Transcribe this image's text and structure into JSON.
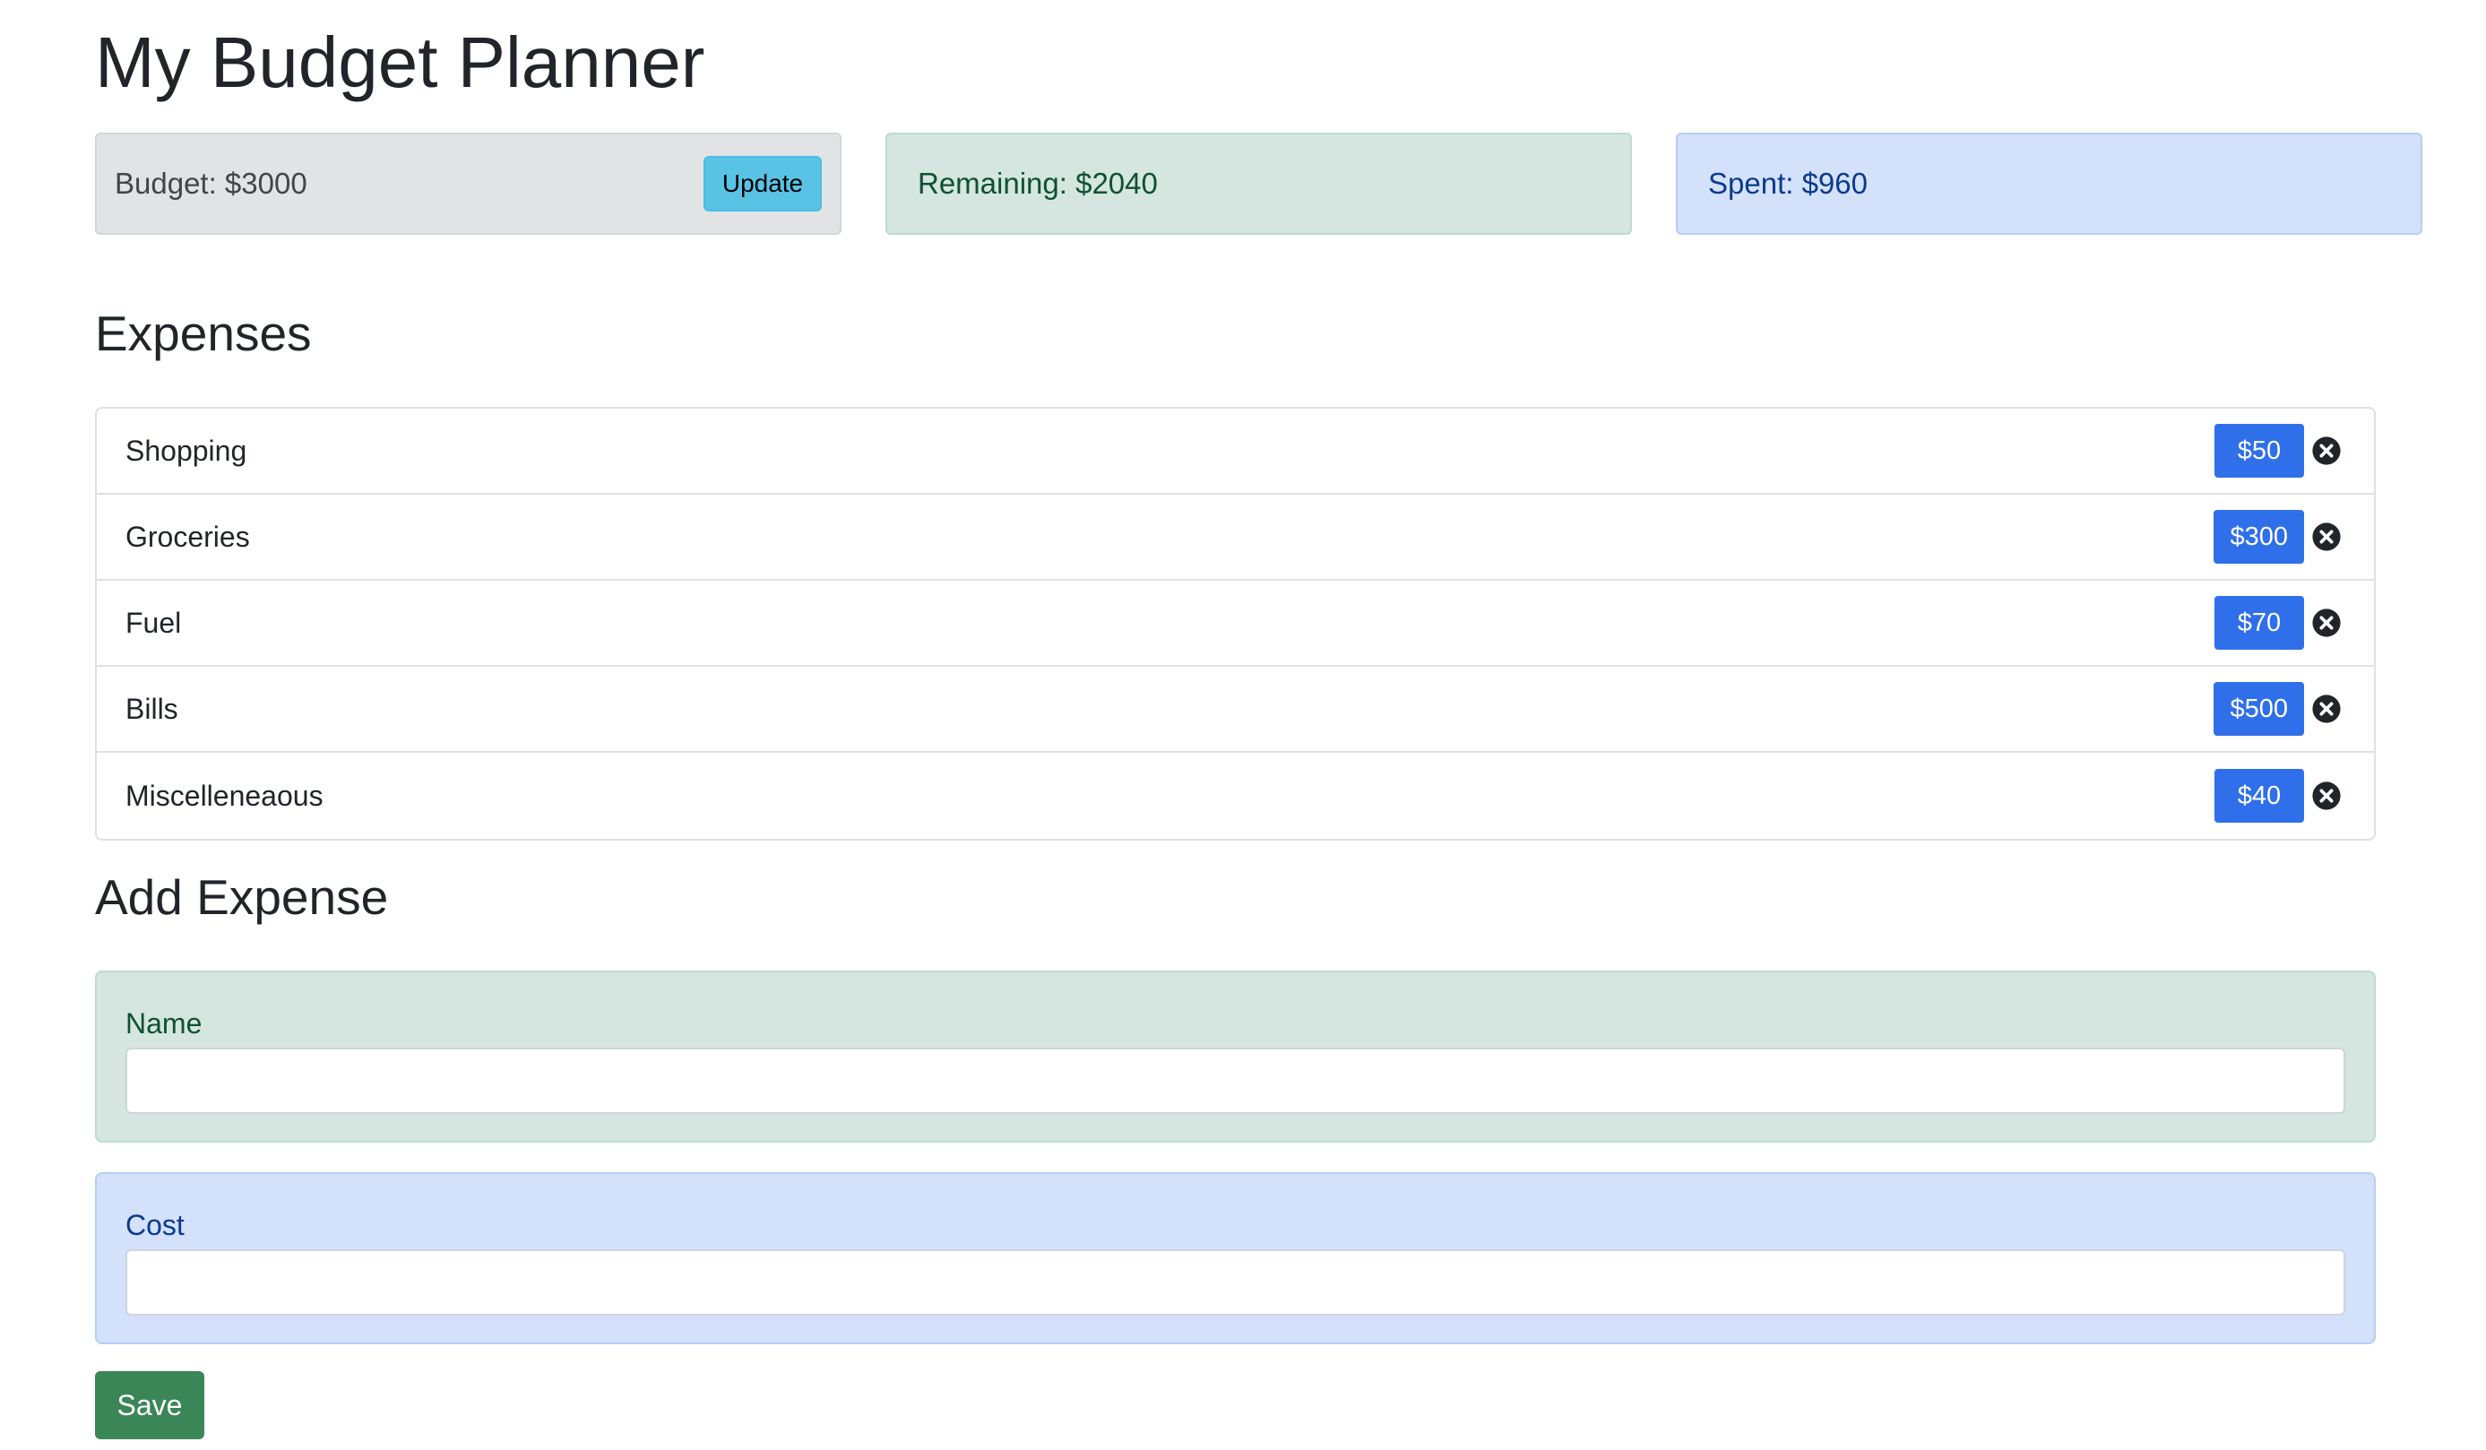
{
  "page": {
    "title": "My Budget Planner"
  },
  "summary": {
    "budget_label": "Budget: $3000",
    "update_button": "Update",
    "remaining_label": "Remaining: $2040",
    "spent_label": "Spent: $960"
  },
  "expenses": {
    "heading": "Expenses",
    "items": [
      {
        "name": "Shopping",
        "cost": "$50"
      },
      {
        "name": "Groceries",
        "cost": "$300"
      },
      {
        "name": "Fuel",
        "cost": "$70"
      },
      {
        "name": "Bills",
        "cost": "$500"
      },
      {
        "name": "Miscelleneaous",
        "cost": "$40"
      }
    ],
    "delete_icon": "close-circle-icon"
  },
  "add_expense": {
    "heading": "Add Expense",
    "name_label": "Name",
    "name_value": "",
    "cost_label": "Cost",
    "cost_value": "",
    "save_button": "Save"
  },
  "colors": {
    "badge": "#2f6fe9",
    "update_button": "#59c3e6",
    "save_button": "#3b8657",
    "budget_card": "#e2e3e5",
    "remaining_card": "#d4e6df",
    "spent_card": "#d4e1fa"
  }
}
